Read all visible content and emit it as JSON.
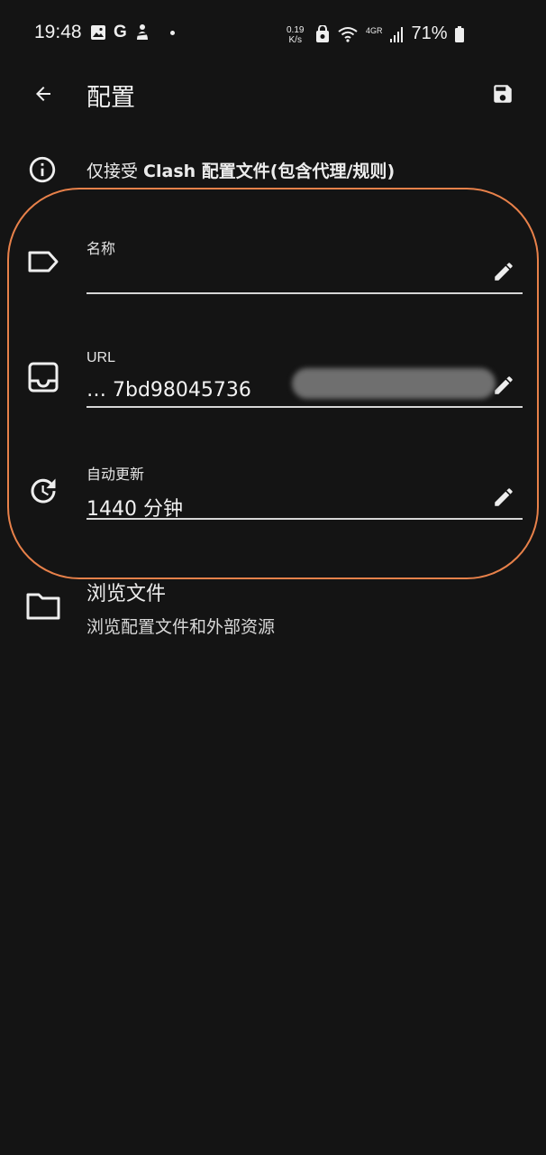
{
  "status_bar": {
    "time": "19:48",
    "google_letter": "G",
    "net_speed_value": "0.19",
    "net_speed_unit": "K/s",
    "network_type": "4GR",
    "battery": "71%"
  },
  "app_bar": {
    "title": "配置"
  },
  "info": {
    "text_prefix": "仅接受 ",
    "text_bold": "Clash",
    "text_suffix": " 配置文件(包含",
    "text_bold2": "代理/规则",
    "text_end": ")"
  },
  "fields": {
    "name": {
      "label": "名称",
      "value": ""
    },
    "url": {
      "label": "URL",
      "value": "…      7bd98045736"
    },
    "auto_update": {
      "label": "自动更新",
      "value": "1440 分钟"
    }
  },
  "browse": {
    "title": "浏览文件",
    "subtitle": "浏览配置文件和外部资源"
  },
  "colors": {
    "background": "#141414",
    "text": "#ededed",
    "highlight": "#e8814a"
  }
}
